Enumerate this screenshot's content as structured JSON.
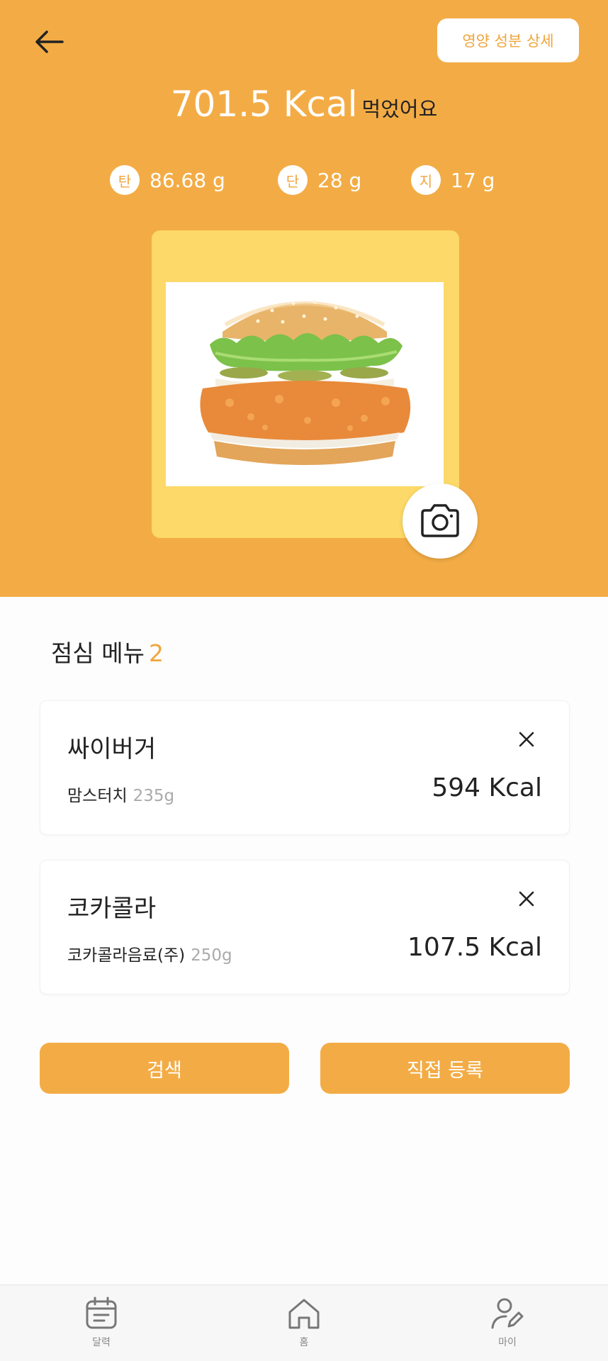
{
  "header": {
    "back_icon": "arrow-left-icon",
    "detail_button_label": "영양 성분 상세",
    "total_kcal": "701.5 Kcal",
    "total_suffix": "먹었어요",
    "accent_color": "#f3ac45",
    "macros": [
      {
        "badge": "탄",
        "value": "86.68 g"
      },
      {
        "badge": "단",
        "value": "28 g"
      },
      {
        "badge": "지",
        "value": "17 g"
      }
    ],
    "photo_alt": "chicken burger",
    "camera_icon": "camera-icon"
  },
  "meal": {
    "title": "점심 메뉴",
    "count": "2",
    "items": [
      {
        "name": "싸이버거",
        "brand": "맘스터치",
        "weight": "235g",
        "kcal": "594 Kcal"
      },
      {
        "name": "코카콜라",
        "brand": "코카콜라음료(주)",
        "weight": "250g",
        "kcal": "107.5 Kcal"
      }
    ]
  },
  "actions": {
    "search_label": "검색",
    "manual_label": "직접 등록"
  },
  "tabbar": {
    "tabs": [
      {
        "label": "달력",
        "icon": "calendar-icon"
      },
      {
        "label": "홈",
        "icon": "home-icon"
      },
      {
        "label": "마이",
        "icon": "user-edit-icon"
      }
    ]
  }
}
